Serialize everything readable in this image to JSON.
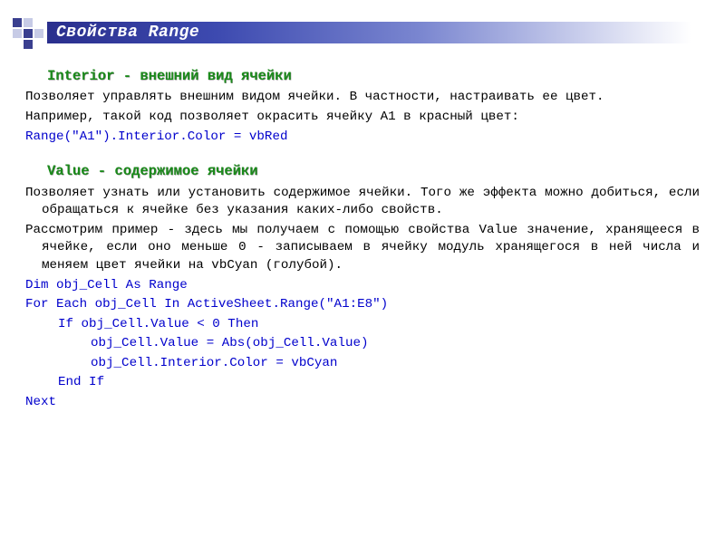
{
  "header": {
    "title": "Свойства Range"
  },
  "section1": {
    "title": "Interior - внешний вид ячейки",
    "p1": "Позволяет управлять внешним видом ячейки. В частности, настраивать ее цвет.",
    "p2": "Например, такой код позволяет окрасить ячейку A1 в красный цвет:",
    "code1": "Range(\"A1\").Interior.Color = vbRed"
  },
  "section2": {
    "title": "Value - содержимое ячейки",
    "p1": "Позволяет узнать или установить содержимое ячейки. Того же эффекта можно добиться, если обращаться к ячейке без указания каких-либо свойств.",
    "p2": "Рассмотрим пример - здесь мы получаем с помощью свойства Value значение, хранящееся в ячейке, если оно меньше 0 - записываем в ячейку модуль хранящегося в ней числа и меняем цвет ячейки на vbCyan (голубой).",
    "code": {
      "l1": "Dim obj_Cell As Range",
      "l2": "For Each obj_Cell In ActiveSheet.Range(\"A1:E8\")",
      "l3": "If obj_Cell.Value < 0 Then",
      "l4": "obj_Cell.Value = Abs(obj_Cell.Value)",
      "l5": "obj_Cell.Interior.Color = vbCyan",
      "l6": "End If",
      "l7": "Next"
    }
  }
}
